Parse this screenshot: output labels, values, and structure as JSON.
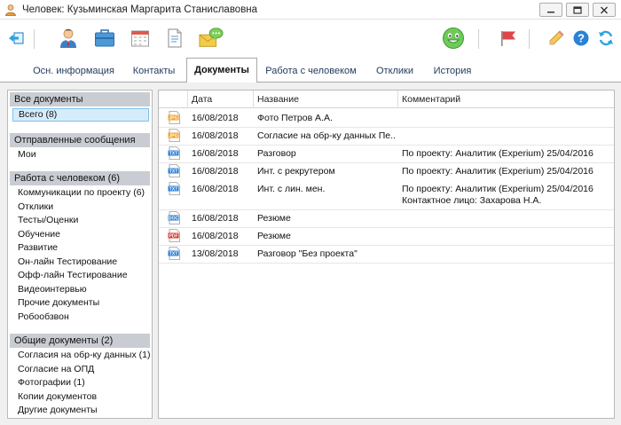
{
  "window": {
    "title": "Человек: Кузьминская Маргарита Станиславовна"
  },
  "toolbar": {
    "icons": [
      "back-icon",
      "person-icon",
      "briefcase-icon",
      "calendar-icon",
      "document-icon",
      "message-icon",
      "smiley-icon",
      "flag-icon",
      "pencil-icon",
      "help-icon",
      "refresh-icon"
    ],
    "help_glyph": "?"
  },
  "tabs": [
    {
      "label": "Осн. информация"
    },
    {
      "label": "Контакты"
    },
    {
      "label": "Документы"
    },
    {
      "label": "Работа с человеком"
    },
    {
      "label": "Отклики"
    },
    {
      "label": "История"
    }
  ],
  "active_tab": "Документы",
  "sidebar": {
    "groups": [
      {
        "header": "Все документы",
        "items": [
          "Всего (8)"
        ]
      },
      {
        "header": "Отправленные сообщения",
        "items": [
          "Мои"
        ]
      },
      {
        "header": "Работа с человеком (6)",
        "items": [
          "Коммуникации по проекту (6)",
          "Отклики",
          "Тесты/Оценки",
          "Обучение",
          "Развитие",
          "Он-лайн Тестирование",
          "Офф-лайн Тестирование",
          "Видеоинтервью",
          "Прочие документы",
          "Робообзвон"
        ]
      },
      {
        "header": "Общие документы (2)",
        "items": [
          "Согласия на обр-ку данных (1)",
          "Согласие на ОПД",
          "Фотографии (1)",
          "Копии документов",
          "Другие документы"
        ]
      }
    ],
    "selected": "Всего (8)"
  },
  "table": {
    "columns": [
      "Дата",
      "Название",
      "Комментарий"
    ],
    "rows": [
      {
        "type": "JPG",
        "color": "#f0a020",
        "date": "16/08/2018",
        "name": "Фото Петров А.А.",
        "comment": "",
        "comment2": ""
      },
      {
        "type": "JPG",
        "color": "#f0a020",
        "date": "16/08/2018",
        "name": "Согласие на обр-ку данных Пе...",
        "comment": "",
        "comment2": ""
      },
      {
        "type": "TXT",
        "color": "#2a7fd4",
        "date": "16/08/2018",
        "name": "Разговор",
        "comment": "По проекту: Аналитик (Experium) 25/04/2016",
        "comment2": ""
      },
      {
        "type": "TXT",
        "color": "#2a7fd4",
        "date": "16/08/2018",
        "name": "Инт. с рекрутером",
        "comment": "По проекту: Аналитик (Experium) 25/04/2016",
        "comment2": ""
      },
      {
        "type": "TXT",
        "color": "#2a7fd4",
        "date": "16/08/2018",
        "name": "Инт. с лин. мен.",
        "comment": "По проекту: Аналитик (Experium) 25/04/2016",
        "comment2": "Контактное лицо: Захарова Н.А."
      },
      {
        "type": "DOC",
        "color": "#2a7fd4",
        "date": "16/08/2018",
        "name": "Резюме",
        "comment": "",
        "comment2": ""
      },
      {
        "type": "PDF",
        "color": "#d9322e",
        "date": "16/08/2018",
        "name": "Резюме",
        "comment": "",
        "comment2": ""
      },
      {
        "type": "TXT",
        "color": "#2a7fd4",
        "date": "13/08/2018",
        "name": "Разговор \"Без проекта\"",
        "comment": "",
        "comment2": ""
      }
    ]
  },
  "colors": {
    "accent": "#2a7fd4",
    "selected_bg": "#d6ecfb",
    "group_header_bg": "#c9cdd3"
  }
}
